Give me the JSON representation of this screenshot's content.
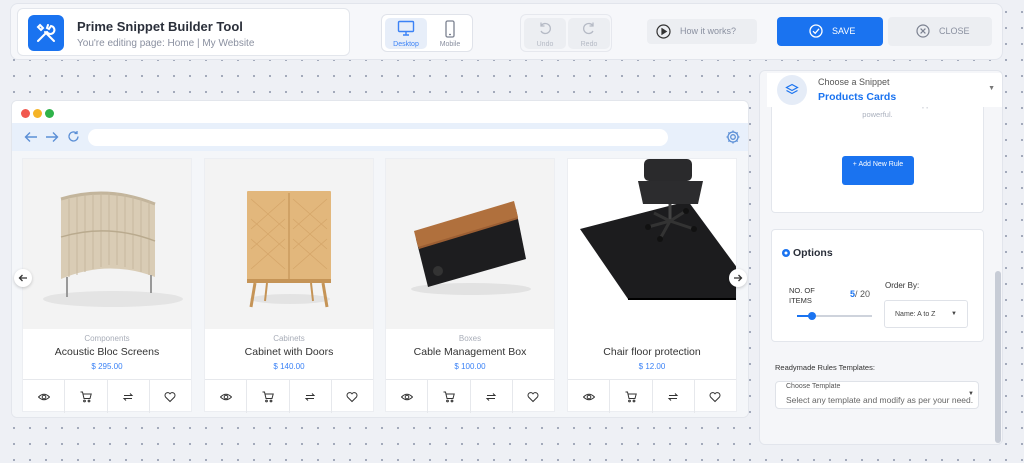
{
  "app": {
    "title": "Prime Snippet Builder Tool",
    "subtitle": "You're editing page: Home | My Website"
  },
  "toolbar": {
    "desktop_label": "Desktop",
    "mobile_label": "Mobile",
    "undo_label": "Undo",
    "redo_label": "Redo",
    "how_label": "How it works?",
    "save_label": "SAVE",
    "close_label": "CLOSE"
  },
  "colors": {
    "accent": "#1a73f0",
    "price": "#3b82f6"
  },
  "browser": {
    "url_value": "",
    "icons": [
      "back-arrow-icon",
      "forward-arrow-icon",
      "refresh-icon",
      "settings-gear-icon"
    ]
  },
  "products": [
    {
      "category": "Components",
      "name": "Acoustic Bloc Screens",
      "price": "$ 295.00"
    },
    {
      "category": "Cabinets",
      "name": "Cabinet with Doors",
      "price": "$ 140.00"
    },
    {
      "category": "Boxes",
      "name": "Cable Management Box",
      "price": "$ 100.00"
    },
    {
      "category": "",
      "name": "Chair floor protection",
      "price": "$ 12.00"
    }
  ],
  "card_actions": [
    "eye-icon",
    "cart-icon",
    "compare-icon",
    "heart-icon"
  ],
  "panel": {
    "snippet_label": "Choose a Snippet",
    "snippet_value": "Products Cards",
    "rules_hint": "Please add some rules and make snippet more powerful.",
    "add_rule_label": "+ Add New Rule",
    "options_title": "Options",
    "items_label": "NO. OF ITEMS",
    "items_value": "5",
    "items_max": "/ 20",
    "items_fraction": 0.2,
    "order_label": "Order By:",
    "order_value": "Name: A to Z",
    "readymade_label": "Readymade Rules Templates:",
    "template_label": "Choose Template",
    "template_placeholder": "Select any template and modify as per your need."
  }
}
